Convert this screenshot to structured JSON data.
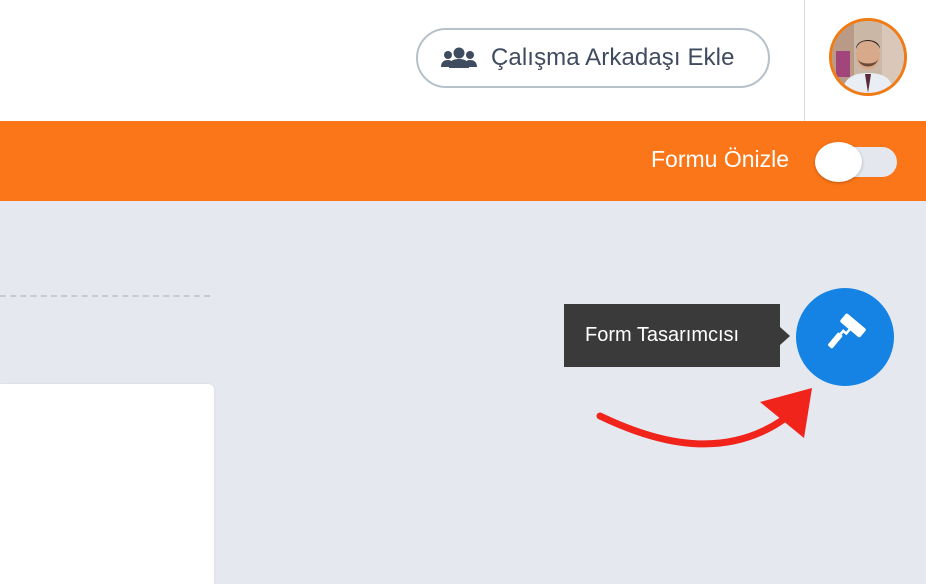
{
  "header": {
    "add_collaborator_label": "Çalışma Arkadaşı Ekle",
    "add_collaborator_icon": "users-icon",
    "avatar_icon": "user-avatar"
  },
  "toolbar": {
    "preview_label": "Formu Önizle",
    "preview_toggle_on": false
  },
  "designer": {
    "tooltip": "Form Tasarımcısı",
    "icon": "paint-roller-icon"
  },
  "colors": {
    "orange_bar": "#fb7618",
    "designer_button": "#1583e4",
    "annotation_arrow": "#f0241b",
    "canvas_background": "#e6e8f0"
  }
}
